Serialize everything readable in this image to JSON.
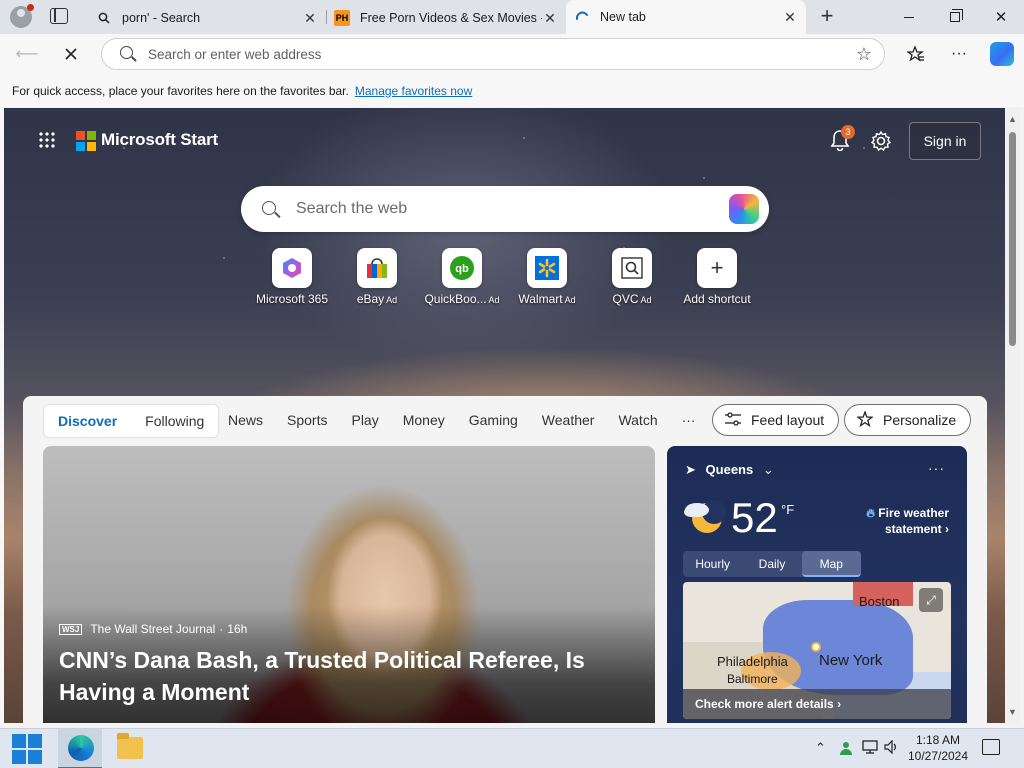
{
  "browser": {
    "tabs": [
      {
        "title": "porn' - Search",
        "close": "✕"
      },
      {
        "favicon": "PH",
        "title": "Free Porn Videos & Sex Movies - P",
        "close": "✕"
      },
      {
        "title": "New tab",
        "close": "✕"
      }
    ],
    "new_tab": "+",
    "address_bar": {
      "placeholder": "Search or enter web address",
      "value": ""
    },
    "favorites_notice": "For quick access, place your favorites here on the favorites bar.",
    "favorites_link": "Manage favorites now"
  },
  "start": {
    "brand": "Microsoft Start",
    "notifications_count": "3",
    "sign_in": "Sign in",
    "search_placeholder": "Search the web",
    "shortcuts": [
      {
        "label": "Microsoft 365",
        "ad": ""
      },
      {
        "label": "eBay",
        "ad": "Ad"
      },
      {
        "label": "QuickBoo...",
        "ad": "Ad"
      },
      {
        "label": "Walmart",
        "ad": "Ad"
      },
      {
        "label": "QVC",
        "ad": "Ad"
      },
      {
        "label": "Add shortcut",
        "ad": ""
      }
    ],
    "feed_tabs": [
      "Discover",
      "Following"
    ],
    "nav": [
      "News",
      "Sports",
      "Play",
      "Money",
      "Gaming",
      "Weather",
      "Watch",
      "···"
    ],
    "feed_layout": "Feed layout",
    "personalize": "Personalize"
  },
  "hero": {
    "source_logo": "WSJ",
    "source": "The Wall Street Journal",
    "age": "16h",
    "headline": "CNN’s Dana Bash, a Trusted Political Referee, Is Having a Moment"
  },
  "weather": {
    "location": "Queens",
    "more": "···",
    "temperature": "52",
    "unit": "°F",
    "alert": "Fire weather statement",
    "tabs": [
      "Hourly",
      "Daily",
      "Map"
    ],
    "active_tab": "Map",
    "map_labels": {
      "boston": "Boston",
      "philadelphia": "Philadelphia",
      "baltimore": "Baltimore",
      "new_york": "New York"
    },
    "cta": "Check more alert details"
  },
  "taskbar": {
    "time": "1:18 AM",
    "date": "10/27/2024"
  },
  "colors": {
    "accent": "#0f6cbd",
    "badge": "#e36a2a",
    "weather_bg": "#1c2c55"
  }
}
